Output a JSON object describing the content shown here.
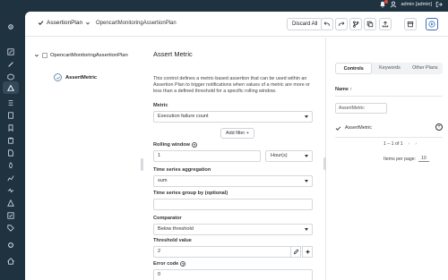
{
  "topbar": {
    "user_label": "admin [admin]"
  },
  "toolbar": {
    "plan_title": "AssertionPlan",
    "plan_subtitle": "OpencartMonitoringAssertionPlan",
    "discard_label": "Discard All"
  },
  "tree": {
    "root_label": "OpencartMonitoringAssertionPlan",
    "child_label": "AssertMetric"
  },
  "form": {
    "title": "Assert Metric",
    "description": "This control defines a metric-based assertion that can be used within an Assertion Plan to trigger notifications when values of a metric are more or less than a defined threshold for a specific rolling window.",
    "metric": {
      "label": "Metric",
      "value": "Execution failure count"
    },
    "add_filter_label": "Add filter",
    "rolling_window": {
      "label": "Rolling window",
      "value": "1",
      "unit": "Hour(s)"
    },
    "aggregation": {
      "label": "Time series aggregation",
      "value": "sum"
    },
    "group_by": {
      "label": "Time series group by (optional)",
      "value": ""
    },
    "comparator": {
      "label": "Comparator",
      "value": "Below threshold"
    },
    "threshold": {
      "label": "Threshold value",
      "value": "2"
    },
    "error_code": {
      "label": "Error code",
      "value": "0"
    }
  },
  "rpanel": {
    "tabs": [
      "Controls",
      "Keywords",
      "Other Plans"
    ],
    "active_tab": 0,
    "column_name": "Name",
    "filter_value": "AssertMetric",
    "row_label": "AssertMetric",
    "pager": "1 – 1 of 1",
    "items_per_page_label": "Items per page:",
    "items_per_page_value": "10"
  }
}
